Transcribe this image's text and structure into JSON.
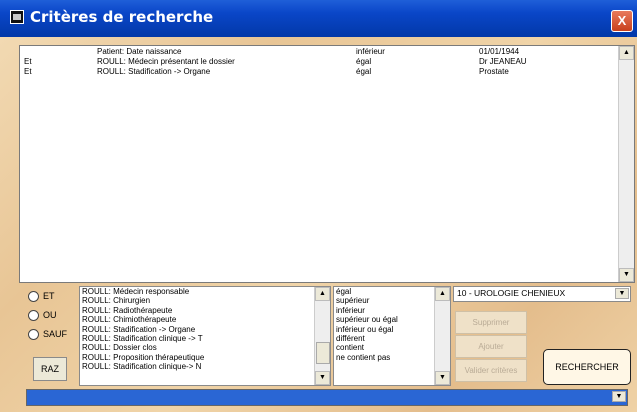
{
  "window": {
    "title": "Critères de recherche",
    "close_label": "X"
  },
  "criteria": [
    {
      "op": "",
      "field": "Patient: Date naissance",
      "comparator": "inférieur",
      "value": "01/01/1944"
    },
    {
      "op": "Et",
      "field": "ROULL: Médecin présentant le dossier",
      "comparator": "égal",
      "value": "Dr JEANEAU"
    },
    {
      "op": "Et",
      "field": "ROULL: Stadification -> Organe",
      "comparator": "égal",
      "value": "Prostate"
    }
  ],
  "logic": {
    "et": "ET",
    "ou": "OU",
    "sauf": "SAUF",
    "raz": "RAZ"
  },
  "fields": [
    "ROULL: Médecin responsable",
    "ROULL: Chirurgien",
    "ROULL: Radiothérapeute",
    "ROULL: Chimiothérapeute",
    "ROULL: Stadification -> Organe",
    "ROULL: Stadification clinique -> T",
    "ROULL: Dossier clos",
    "ROULL: Proposition thérapeutique",
    "ROULL: Stadification clinique-> N"
  ],
  "comparators": [
    "égal",
    "supérieur",
    "inférieur",
    "supérieur ou égal",
    "inférieur ou égal",
    "différent",
    "contient",
    "ne contient pas"
  ],
  "value_select": "10 - UROLOGIE CHENIEUX",
  "buttons": {
    "supprimer": "Supprimer",
    "ajouter": "Ajouter",
    "valider": "Valider critères",
    "rechercher": "RECHERCHER"
  },
  "icons": {
    "arrow_up": "▲",
    "arrow_down": "▼"
  }
}
